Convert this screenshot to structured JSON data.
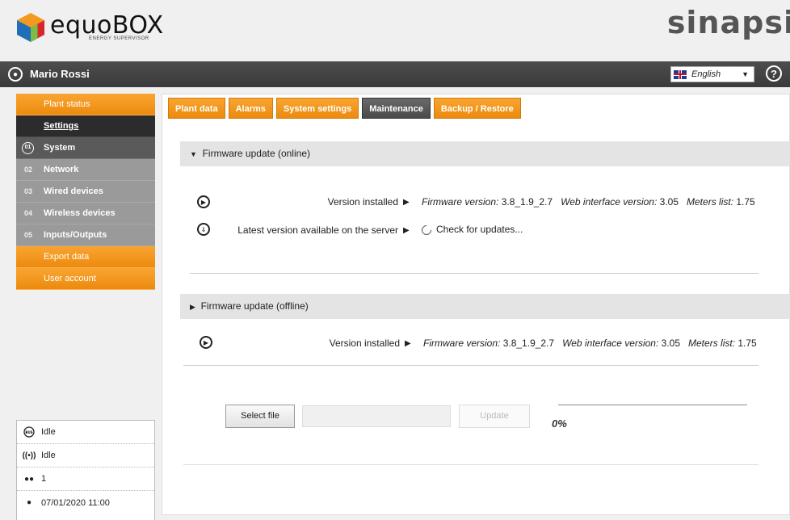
{
  "header": {
    "logo_text": "equoBOX",
    "logo_subtitle": "ENERGY SUPERVISOR",
    "brand": "sinapsi"
  },
  "userbar": {
    "user_name": "Mario Rossi",
    "language": "English"
  },
  "sidebar": {
    "items": [
      {
        "label": "Plant status"
      },
      {
        "label": "Settings"
      },
      {
        "num": "01",
        "label": "System"
      },
      {
        "num": "02",
        "label": "Network"
      },
      {
        "num": "03",
        "label": "Wired devices"
      },
      {
        "num": "04",
        "label": "Wireless devices"
      },
      {
        "num": "05",
        "label": "Inputs/Outputs"
      },
      {
        "label": "Export data"
      },
      {
        "label": "User account"
      }
    ],
    "status": {
      "bus_badge": "BUS",
      "bus_state": "Idle",
      "wireless_state": "Idle",
      "users_count": "1",
      "datetime": "07/01/2020 11:00"
    }
  },
  "tabs": [
    {
      "label": "Plant data"
    },
    {
      "label": "Alarms"
    },
    {
      "label": "System settings"
    },
    {
      "label": "Maintenance"
    },
    {
      "label": "Backup / Restore"
    }
  ],
  "online": {
    "title": "Firmware update (online)",
    "version_installed_label": "Version installed",
    "firmware_label": "Firmware version:",
    "firmware_value": "3.8_1.9_2.7",
    "web_label": "Web interface version:",
    "web_value": "3.05",
    "meters_label": "Meters list:",
    "meters_value": "1.75",
    "latest_label": "Latest version available on the server",
    "check_label": "Check for updates..."
  },
  "offline": {
    "title": "Firmware update (offline)",
    "version_installed_label": "Version installed",
    "firmware_label": "Firmware version:",
    "firmware_value": "3.8_1.9_2.7",
    "web_label": "Web interface version:",
    "web_value": "3.05",
    "meters_label": "Meters list:",
    "meters_value": "1.75",
    "select_file_label": "Select file",
    "update_label": "Update",
    "progress_text": "0%",
    "progress": 0
  }
}
